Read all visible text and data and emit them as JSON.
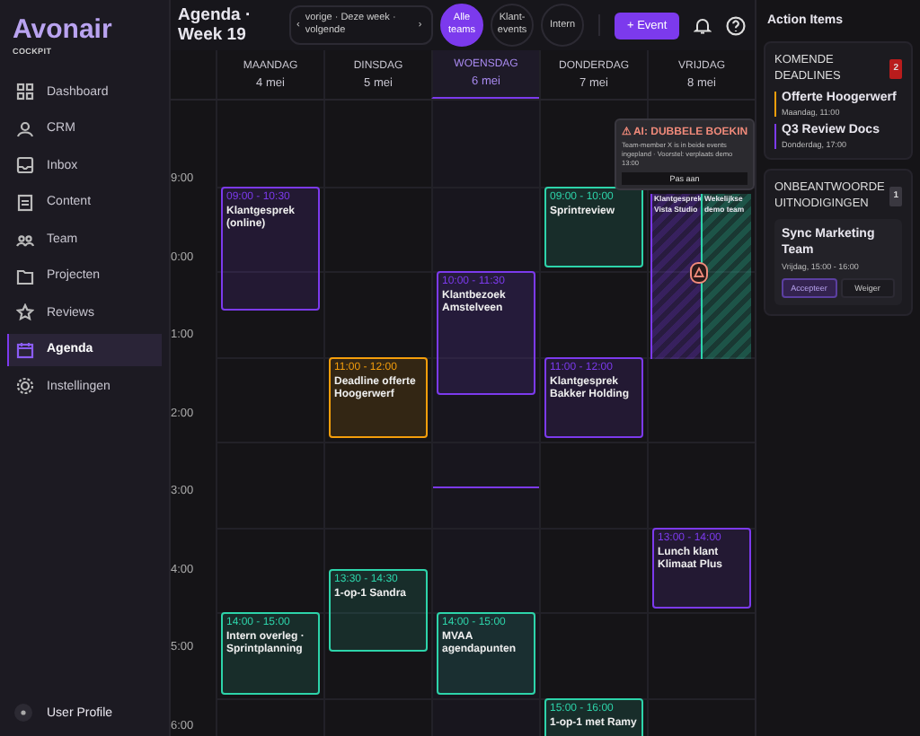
{
  "brand": {
    "name": "Avonair",
    "sub": "COCKPIT"
  },
  "sidebar": {
    "items": [
      {
        "label": "Dashboard",
        "selected": false
      },
      {
        "label": "CRM",
        "selected": false
      },
      {
        "label": "Inbox",
        "selected": false
      },
      {
        "label": "Content",
        "selected": false
      },
      {
        "label": "Team",
        "selected": false
      },
      {
        "label": "Projecten",
        "selected": false
      },
      {
        "label": "Reviews",
        "selected": false
      },
      {
        "label": "Agenda",
        "selected": true
      },
      {
        "label": "Instellingen",
        "selected": false
      }
    ],
    "user": "User Profile"
  },
  "header": {
    "title": "Agenda · Week 19",
    "prev": "‹",
    "nav": "vorige · Deze week · volgende",
    "next": "›",
    "filters": [
      {
        "label": "Alle teams",
        "selected": true
      },
      {
        "label": "Klant-events",
        "selected": false
      },
      {
        "label": "Intern",
        "selected": false
      }
    ],
    "add_button": "+ Event"
  },
  "days": [
    {
      "name": "MAANDAG",
      "date": "4 mei",
      "selected": false,
      "events": [
        {
          "time": "09:00 - 10:30",
          "title": "Klantgesprek (online)",
          "color": "#7c3aed"
        },
        {
          "time": "14:00 - 15:00",
          "title": "Intern overleg · Sprintplanning",
          "color": "#2dd4aa"
        }
      ]
    },
    {
      "name": "DINSDAG",
      "date": "5 mei",
      "selected": false,
      "events": [
        {
          "time": "11:00 - 12:00",
          "title": "Deadline offerte Hoogerwerf",
          "color": "#f59e0b"
        },
        {
          "time": "13:30 - 14:30",
          "title": "1-op-1 Sandra",
          "color": "#2dd4aa"
        }
      ]
    },
    {
      "name": "WOENSDAG",
      "date": "6 mei",
      "selected": true,
      "now_line": true,
      "events": [
        {
          "time": "10:00 - 11:30",
          "title": "Klantbezoek Amstelveen",
          "color": "#7c3aed"
        },
        {
          "time": "14:00 - 15:00",
          "title": "MVAA agendapunten",
          "color": "#2dd4aa"
        }
      ]
    },
    {
      "name": "DONDERDAG",
      "date": "7 mei",
      "selected": false,
      "events": [
        {
          "time": "09:00 - 10:00",
          "title": "Sprintreview",
          "color": "#2dd4aa"
        },
        {
          "time": "11:00 - 12:00",
          "title": "Klantgesprek Bakker Holding",
          "color": "#7c3aed"
        },
        {
          "time": "15:00 - 16:00",
          "title": "1-op-1 met Ramy",
          "color": "#2dd4aa"
        }
      ]
    },
    {
      "name": "VRIJDAG",
      "date": "8 mei",
      "selected": false,
      "events": [
        {
          "time": "13:00 - 14:00",
          "title": "Lunch klant Klimaat Plus",
          "color": "#7c3aed"
        }
      ],
      "conflict": {
        "events": [
          {
            "title": "Klantgesprek Vista Studio",
            "color": "#7c3aed"
          },
          {
            "title": "Wekelijkse demo team",
            "color": "#2dd4aa"
          }
        ],
        "alert": {
          "title": "⚠ AI: DUBBELE BOEKIN",
          "text": "Team-member X is in beide events ingepland · Voorstel: verplaats demo 13:00",
          "button": "Pas aan"
        }
      }
    }
  ],
  "hours": [
    "9:00",
    "0:00",
    "1:00",
    "2:00",
    "3:00",
    "4:00",
    "5:00",
    "6:00"
  ],
  "panel": {
    "title": "Action Items",
    "deadlines": {
      "title": "KOMENDE DEADLINES",
      "count": "2",
      "items": [
        {
          "title": "Offerte Hoogerwerf",
          "when": "Maandag, 11:00",
          "color": "#f59e0b"
        },
        {
          "title": "Q3 Review Docs",
          "when": "Donderdag, 17:00",
          "color": "#7c3aed"
        }
      ]
    },
    "invites": {
      "title": "ONBEANTWOORDE UITNODIGINGEN",
      "count": "1",
      "items": [
        {
          "title": "Sync Marketing Team",
          "when": "Vrijdag, 15:00 - 16:00",
          "accept": "Accepteer",
          "decline": "Weiger"
        }
      ]
    }
  }
}
